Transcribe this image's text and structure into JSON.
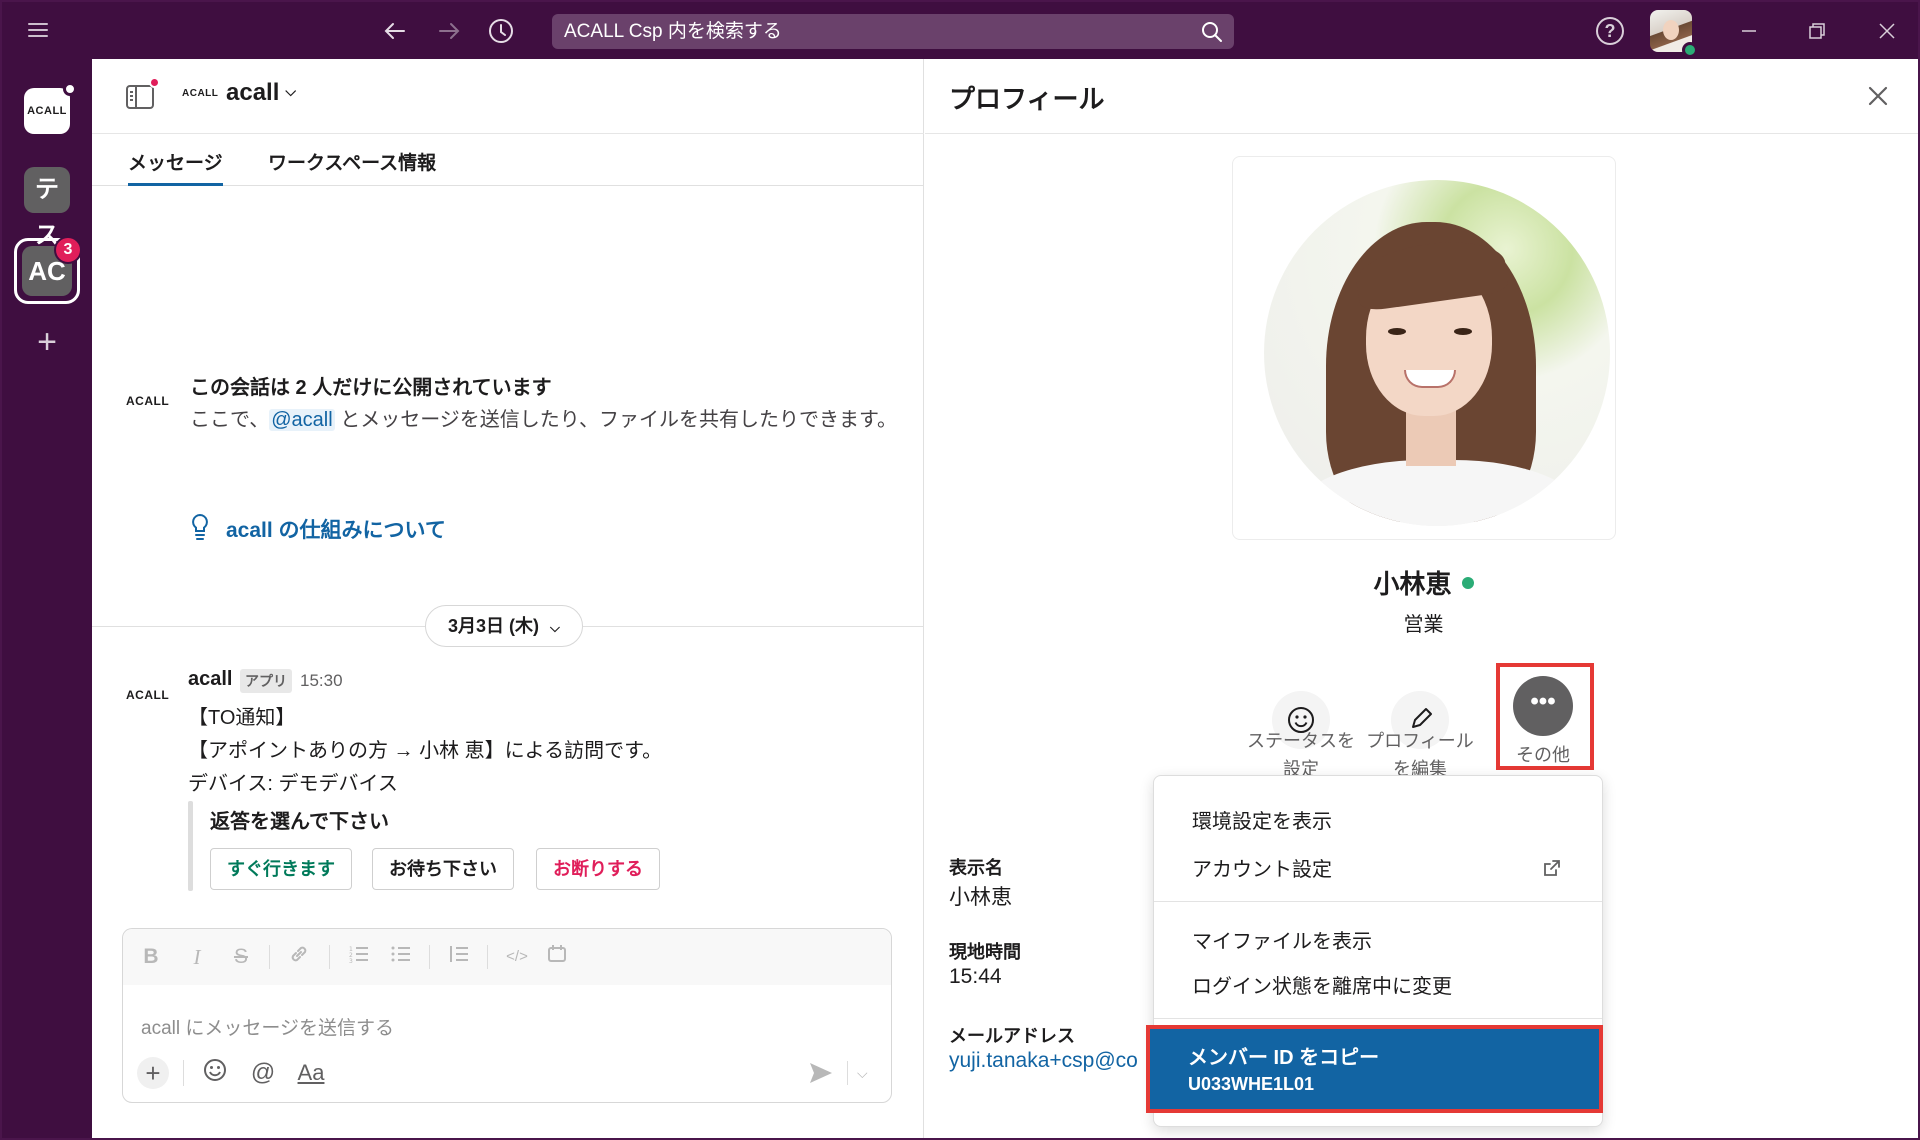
{
  "titlebar": {
    "search_placeholder": "ACALL Csp 内を検索する"
  },
  "rail": {
    "workspaces": [
      {
        "label": "ACALL",
        "active": false
      },
      {
        "label": "テス",
        "active": false
      },
      {
        "label": "AC",
        "active": true,
        "badge": "3"
      }
    ]
  },
  "channel": {
    "logo_text": "ACALL",
    "name": "acall",
    "tabs": [
      "メッセージ",
      "ワークスペース情報"
    ],
    "intro": {
      "logo_text": "ACALL",
      "title": "この会話は 2 人だけに公開されています",
      "text_before": "ここで、",
      "mention": "@acall",
      "text_after": " とメッセージを送信したり、ファイルを共有したりできます。",
      "howto_link": "acall の仕組みについて"
    },
    "date_pill": "3月3日 (木)",
    "message": {
      "logo_text": "ACALL",
      "author": "acall",
      "app_badge": "アプリ",
      "time": "15:30",
      "lines": [
        "【TO通知】",
        "【アポイントありの方 → 小林 恵】による訪問です。",
        "デバイス: デモデバイス"
      ],
      "attachment_title": "返答を選んで下さい",
      "buttons": [
        "すぐ行きます",
        "お待ち下さい",
        "お断りする"
      ]
    },
    "composer": {
      "placeholder": "acall にメッセージを送信する",
      "format_tools": [
        "bold-icon",
        "italic-icon",
        "strikethrough-icon",
        "link-icon",
        "ordered-list-icon",
        "bullet-list-icon",
        "blockquote-icon",
        "code-icon",
        "code-block-icon"
      ],
      "bottom_tools": [
        "plus-icon",
        "emoji-icon",
        "mention-icon",
        "text-format-icon"
      ],
      "aa_label": "Aa"
    }
  },
  "profile": {
    "title": "プロフィール",
    "name": "小林恵",
    "role": "営業",
    "actions": [
      {
        "line1": "ステータスを",
        "line2": "設定"
      },
      {
        "line1": "プロフィール",
        "line2": "を編集"
      }
    ],
    "more_label": "その他",
    "fields": {
      "display_name_label": "表示名",
      "display_name_value": "小林恵",
      "local_time_label": "現地時間",
      "local_time_value": "15:44",
      "email_label": "メールアドレス",
      "email_value": "yuji.tanaka+csp@co"
    }
  },
  "menu": {
    "items_group1": [
      "環境設定を表示",
      "アカウント設定"
    ],
    "items_group2": [
      "マイファイルを表示",
      "ログイン状態を離席中に変更"
    ],
    "highlighted": {
      "label": "メンバー ID をコピー",
      "sub": "U033WHE1L01"
    }
  },
  "colors": {
    "titlebar": "#3f0e40",
    "link": "#1264a3",
    "online": "#2bac76",
    "badge": "#e01e5a",
    "highlight_box": "#e53935"
  }
}
